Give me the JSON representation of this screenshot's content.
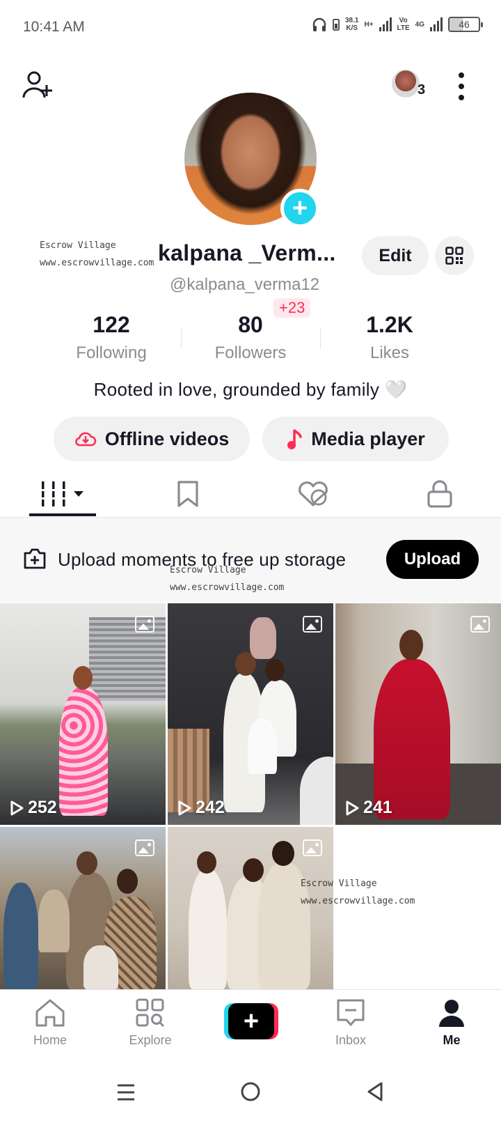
{
  "status_bar": {
    "time": "10:41 AM",
    "net_speed_value": "38.1",
    "net_speed_unit": "K/S",
    "network_1": "H+",
    "network_2_top": "Vo",
    "network_2_bottom": "LTE",
    "network_3": "4G",
    "battery": "46"
  },
  "header": {
    "notification_count": "3"
  },
  "watermark": {
    "line1": "Escrow Village",
    "line2": "www.escrowvillage.com"
  },
  "profile": {
    "display_name": "kalpana _Verm...",
    "username": "@kalpana_verma12",
    "edit_label": "Edit",
    "bio": "Rooted in love, grounded by family 🤍"
  },
  "stats": [
    {
      "value": "122",
      "label": "Following"
    },
    {
      "value": "80",
      "label": "Followers"
    },
    {
      "value": "1.2K",
      "label": "Likes"
    }
  ],
  "new_followers_badge": "+23",
  "actions": {
    "offline_videos": "Offline videos",
    "media_player": "Media player"
  },
  "banner": {
    "text": "Upload moments to free up storage",
    "button": "Upload"
  },
  "posts": [
    {
      "views": "252"
    },
    {
      "views": "242"
    },
    {
      "views": "241"
    },
    {
      "views": ""
    },
    {
      "views": ""
    }
  ],
  "nav": {
    "home": "Home",
    "explore": "Explore",
    "inbox": "Inbox",
    "me": "Me"
  },
  "colors": {
    "accent_red": "#fe2c55",
    "accent_cyan": "#20d5ec",
    "text_primary": "#161823",
    "text_secondary": "#8a8b91"
  }
}
